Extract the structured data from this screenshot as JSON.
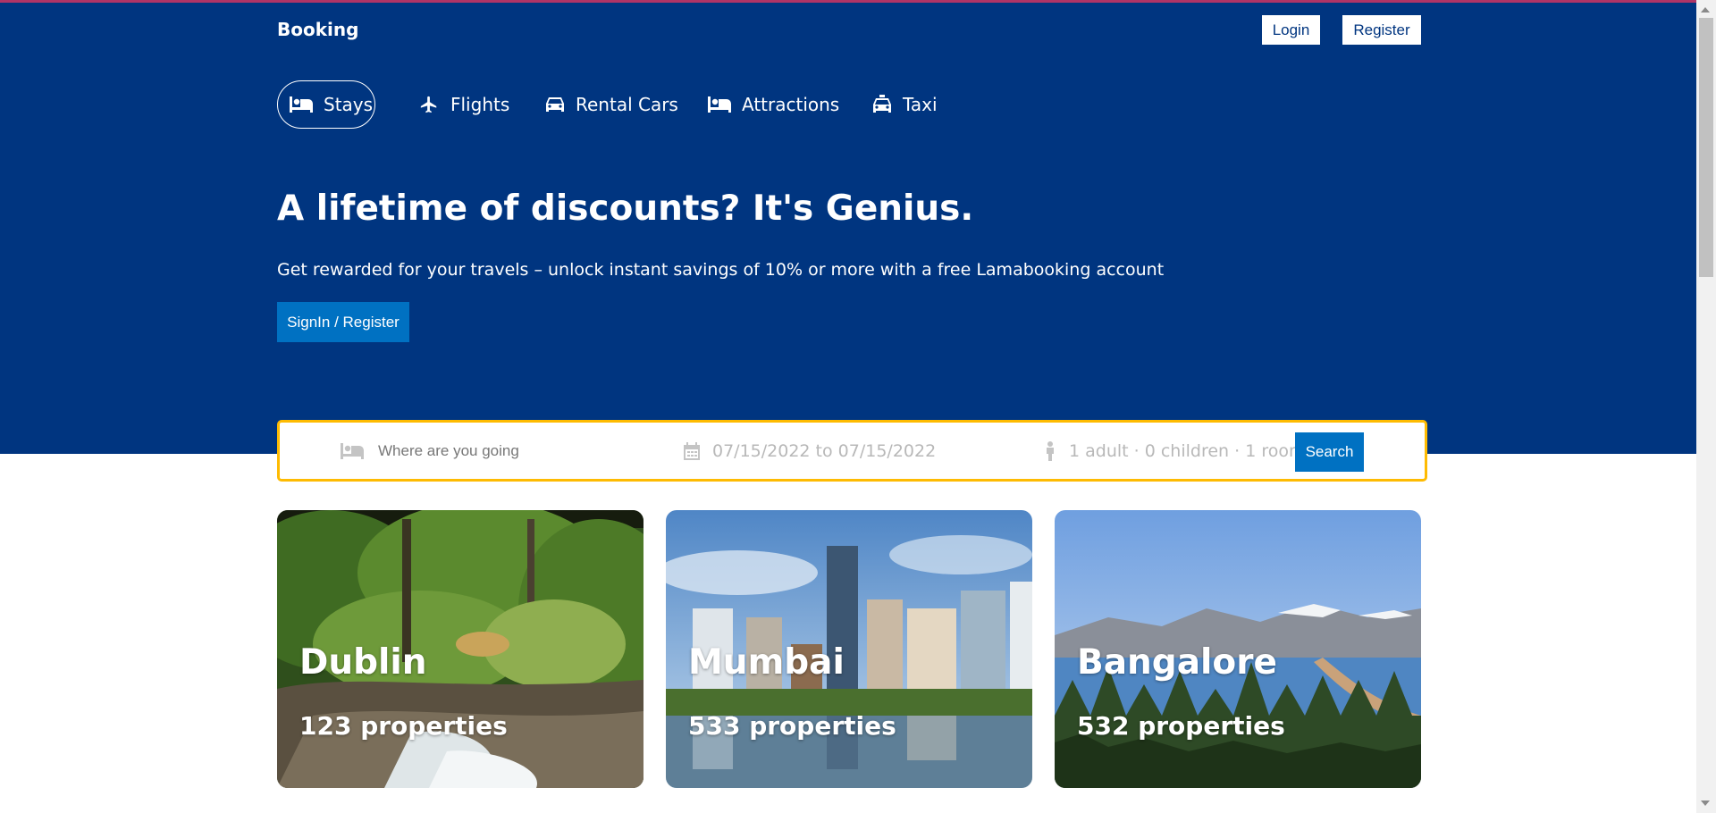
{
  "header": {
    "brand": "Booking",
    "login_label": "Login",
    "register_label": "Register",
    "nav": [
      {
        "label": "Stays",
        "icon": "bed-icon",
        "active": true
      },
      {
        "label": "Flights",
        "icon": "plane-icon"
      },
      {
        "label": "Rental Cars",
        "icon": "car-icon"
      },
      {
        "label": "Attractions",
        "icon": "bed-icon"
      },
      {
        "label": "Taxi",
        "icon": "taxi-icon"
      }
    ],
    "hero_title": "A lifetime of discounts? It's Genius.",
    "hero_desc": "Get rewarded for your travels – unlock instant savings of 10% or more with a free Lamabooking account",
    "signin_label": "SignIn / Register"
  },
  "search": {
    "destination_placeholder": "Where are you going",
    "date_range": "07/15/2022 to 07/15/2022",
    "guests": "1 adult · 0 children · 1 room",
    "search_label": "Search"
  },
  "featured": [
    {
      "city": "Dublin",
      "properties": "123 properties"
    },
    {
      "city": "Mumbai",
      "properties": "533 properties"
    },
    {
      "city": "Bangalore",
      "properties": "532 properties"
    }
  ],
  "colors": {
    "header_bg": "#003580",
    "accent_button": "#0071c2",
    "search_border": "#febb02",
    "top_border": "#b03466"
  }
}
